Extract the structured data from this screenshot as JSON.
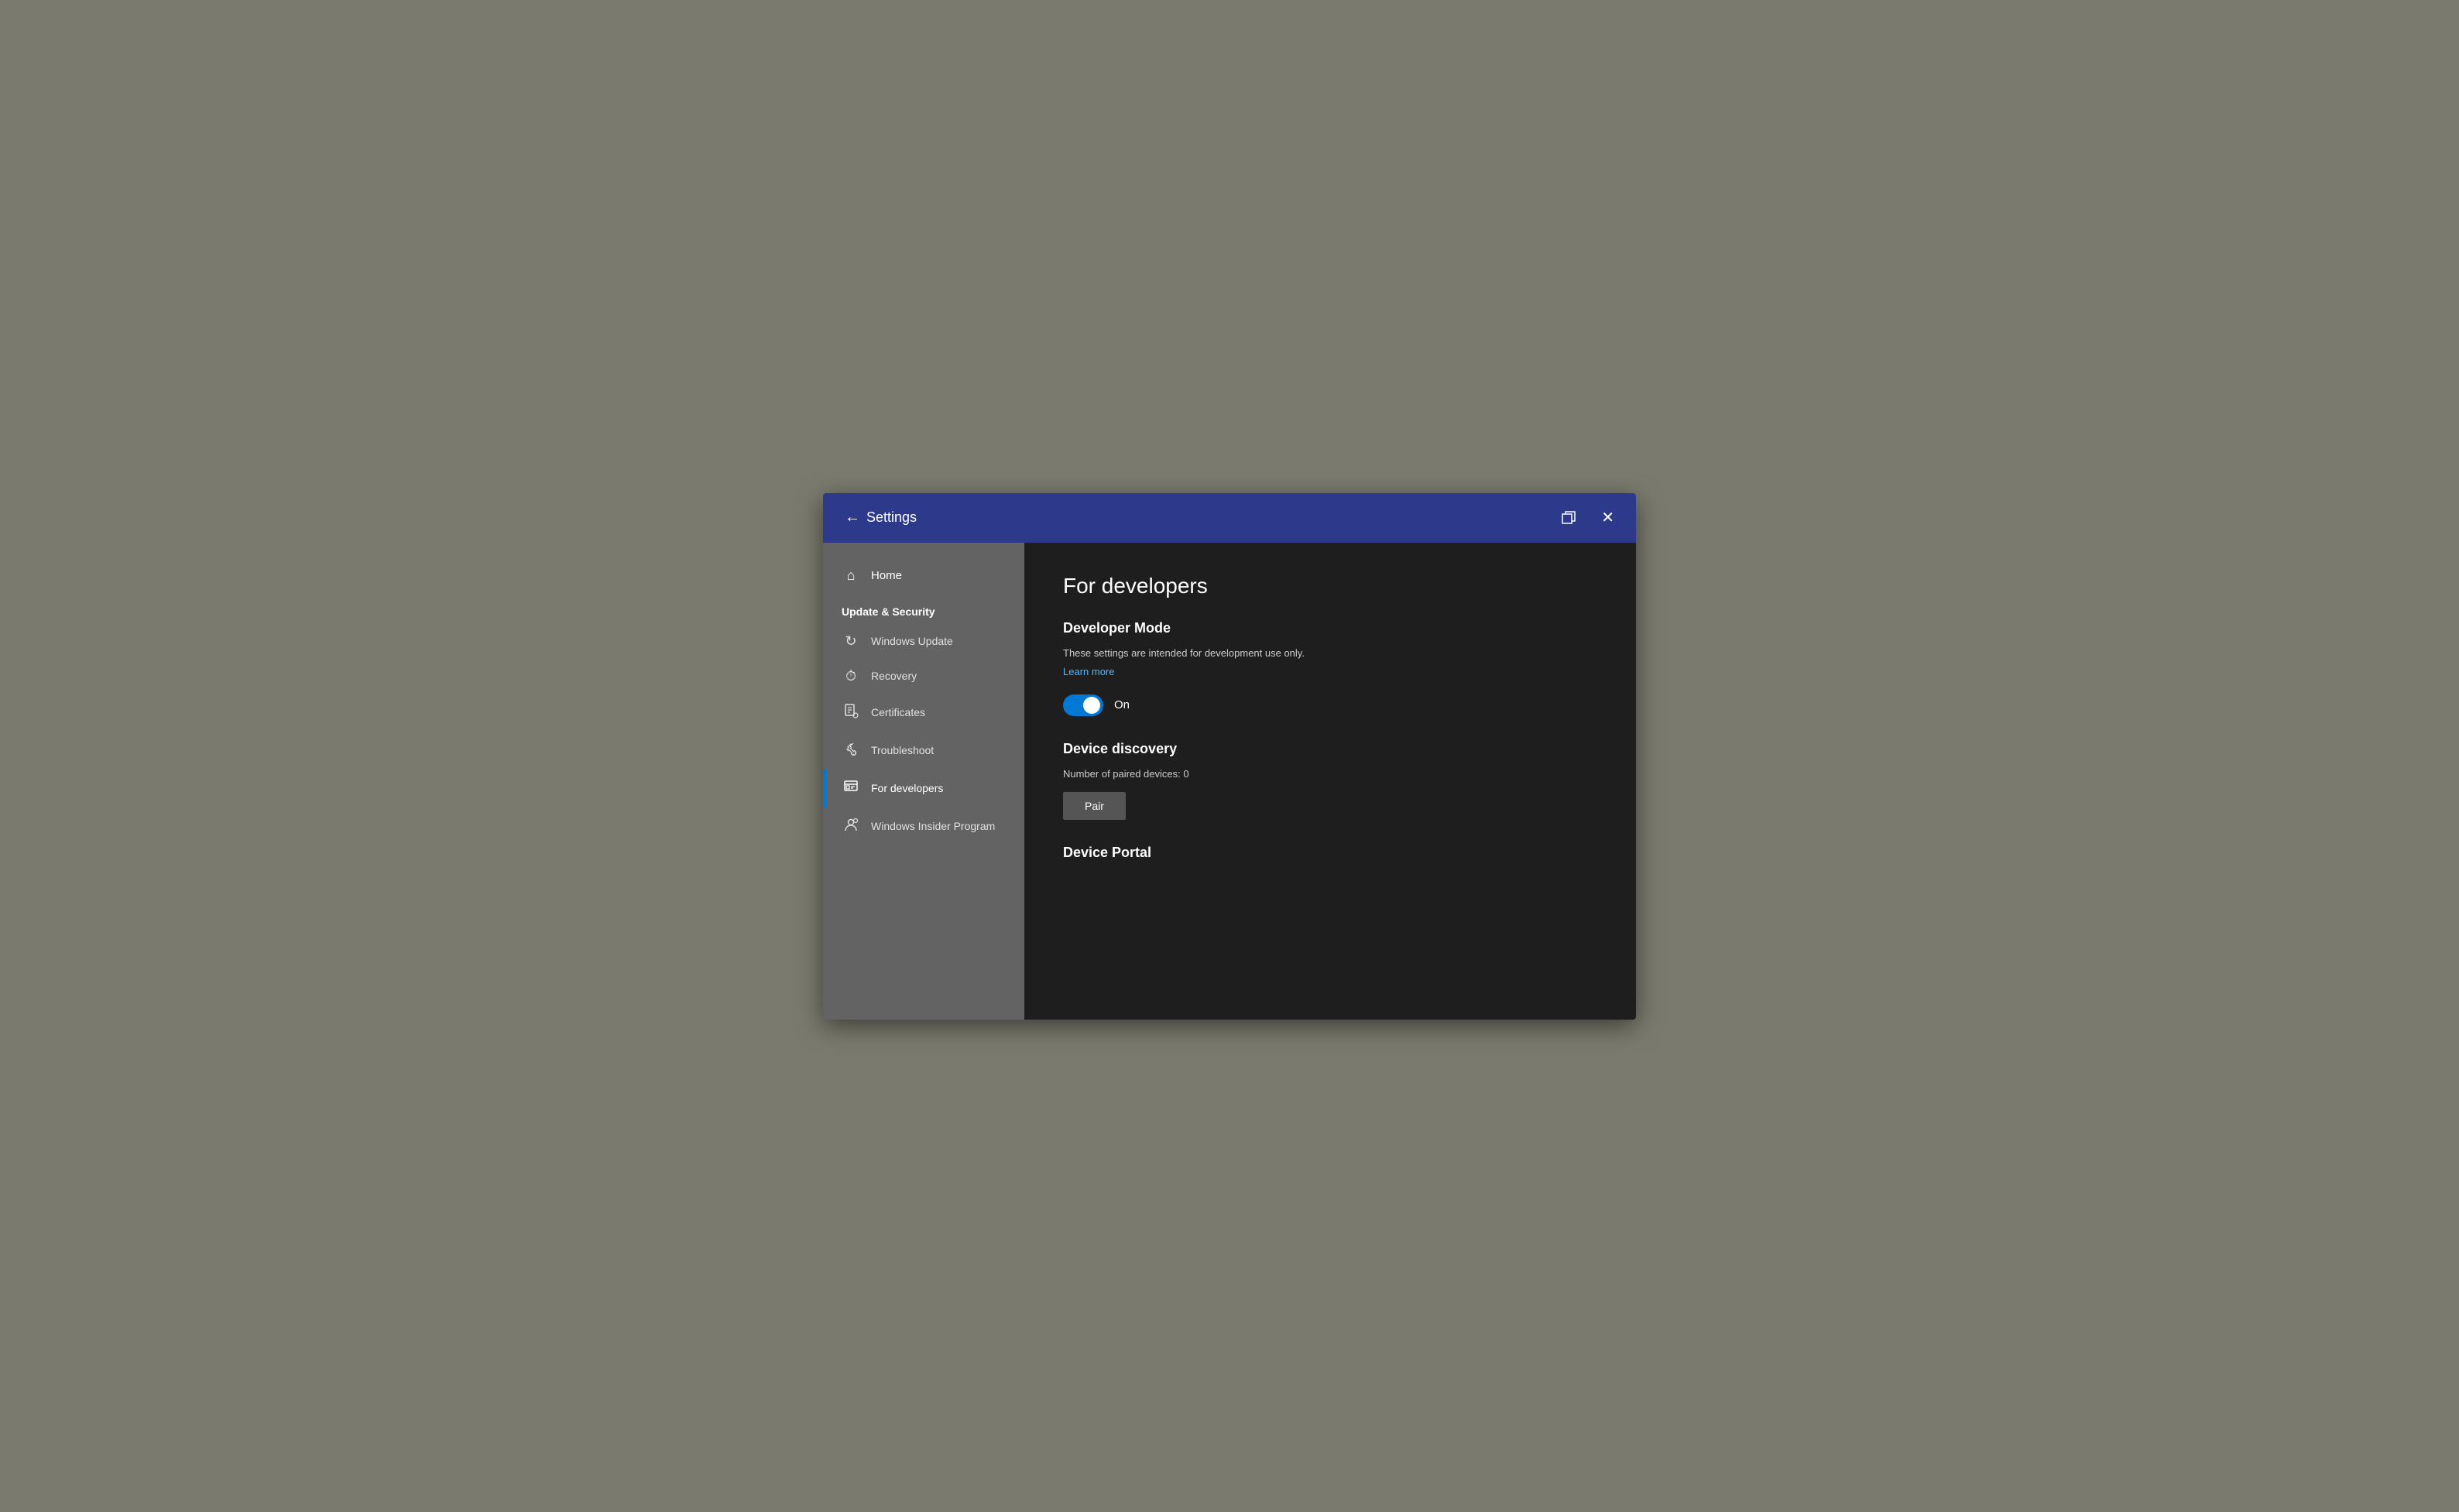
{
  "titlebar": {
    "title": "Settings",
    "back_label": "←",
    "close_label": "✕"
  },
  "sidebar": {
    "home_label": "Home",
    "section_title": "Update & Security",
    "items": [
      {
        "id": "windows-update",
        "label": "Windows Update",
        "icon": "↻",
        "active": false
      },
      {
        "id": "recovery",
        "label": "Recovery",
        "icon": "⏱",
        "active": false
      },
      {
        "id": "certificates",
        "label": "Certificates",
        "icon": "📋",
        "active": false
      },
      {
        "id": "troubleshoot",
        "label": "Troubleshoot",
        "icon": "🔧",
        "active": false
      },
      {
        "id": "for-developers",
        "label": "For developers",
        "icon": "⊞",
        "active": true
      },
      {
        "id": "windows-insider",
        "label": "Windows Insider Program",
        "icon": "👤",
        "active": false
      }
    ]
  },
  "content": {
    "page_title": "For developers",
    "developer_mode": {
      "section_title": "Developer Mode",
      "description": "These settings are intended for development use only.",
      "learn_more": "Learn more",
      "toggle_state": "On"
    },
    "device_discovery": {
      "section_title": "Device discovery",
      "paired_devices_label": "Number of paired devices: 0",
      "pair_button_label": "Pair"
    },
    "device_portal": {
      "section_title": "Device Portal"
    }
  },
  "colors": {
    "titlebar_bg": "#2d3a8c",
    "sidebar_bg": "#636363",
    "content_bg": "#1e1e1e",
    "active_indicator": "#0078d4",
    "toggle_on": "#0078d4",
    "link_color": "#4db8ff"
  }
}
